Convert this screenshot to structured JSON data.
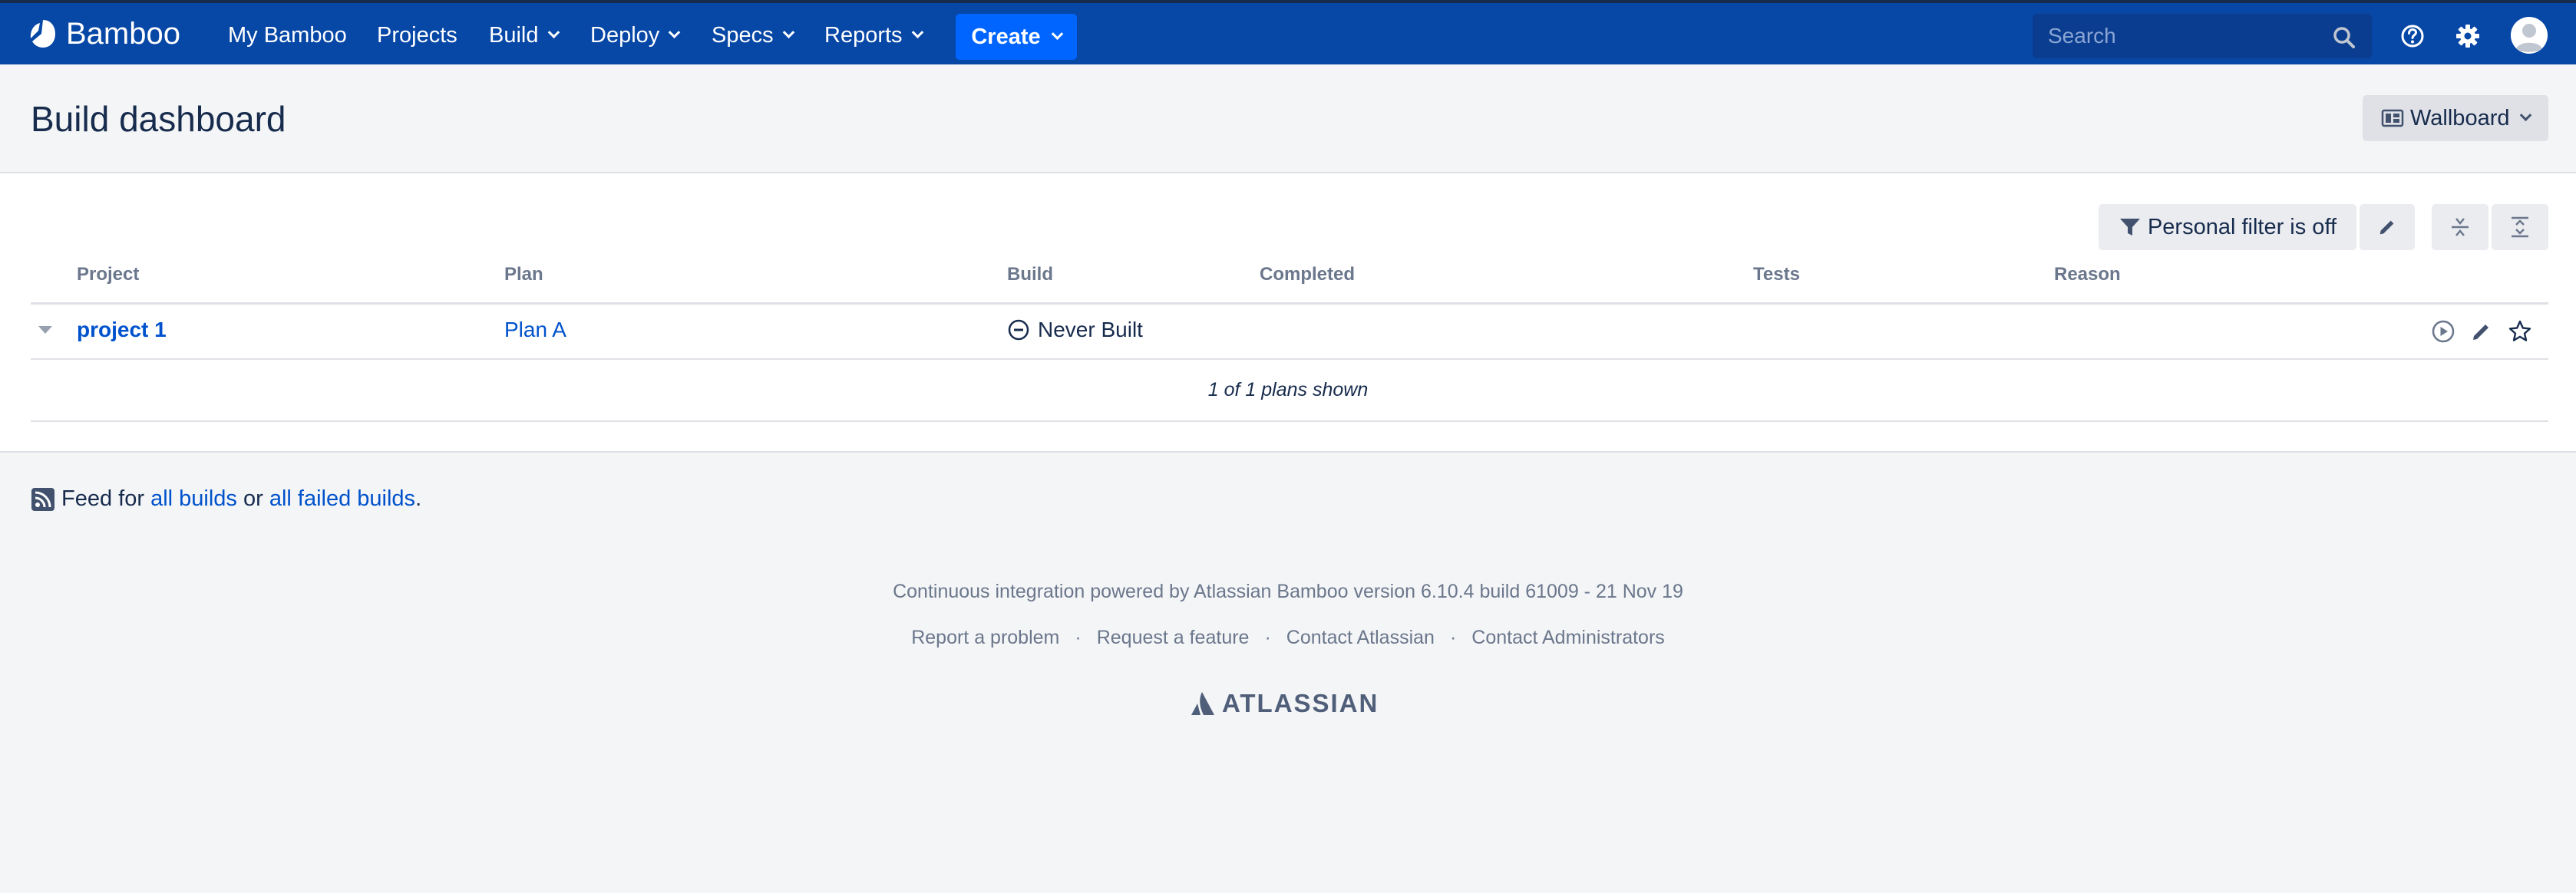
{
  "app": {
    "name": "Bamboo",
    "nav": [
      "My Bamboo",
      "Projects",
      "Build",
      "Deploy",
      "Specs",
      "Reports"
    ],
    "create_label": "Create",
    "search_placeholder": "Search"
  },
  "page": {
    "title": "Build dashboard",
    "wallboard_label": "Wallboard"
  },
  "toolbar": {
    "filter_label": "Personal filter is off"
  },
  "table": {
    "columns": [
      "Project",
      "Plan",
      "Build",
      "Completed",
      "Tests",
      "Reason"
    ],
    "rows": [
      {
        "project": "project 1",
        "plan": "Plan A",
        "build": "Never Built",
        "completed": "",
        "tests": "",
        "reason": ""
      }
    ],
    "summary": "1 of 1 plans shown"
  },
  "feed": {
    "prefix": "Feed for",
    "all_builds": "all builds",
    "or": "or",
    "failed_builds": "all failed builds",
    "suffix": "."
  },
  "footer": {
    "powered": "Continuous integration powered by Atlassian Bamboo version 6.10.4 build 61009 - 21 Nov 19",
    "links": [
      "Report a problem",
      "Request a feature",
      "Contact Atlassian",
      "Contact Administrators"
    ],
    "separator": "·",
    "brand": "ATLASSIAN"
  },
  "colors": {
    "header_bg": "#0747a6",
    "create_bg": "#0065ff",
    "link": "#0052cc",
    "page_bg": "#f4f5f7"
  }
}
